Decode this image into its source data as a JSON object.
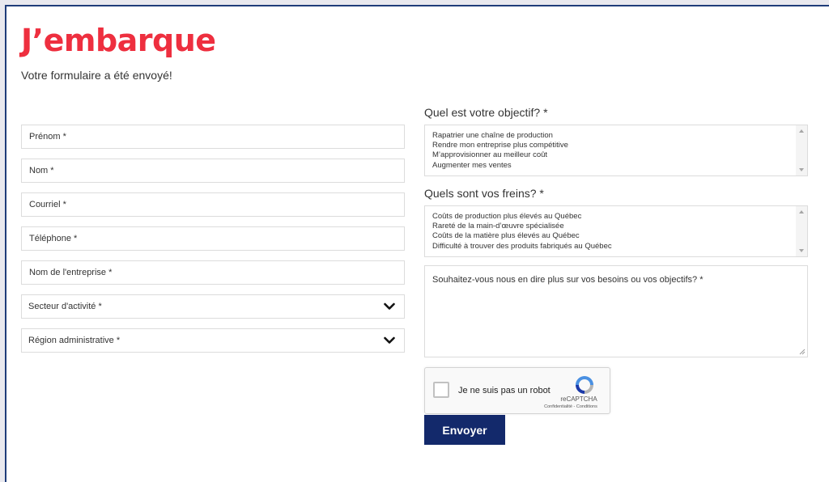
{
  "header": {
    "brand": "J’embarque",
    "success_message": "Votre formulaire a été envoyé!"
  },
  "form": {
    "fields": [
      {
        "label": "Prénom *"
      },
      {
        "label": "Nom *"
      },
      {
        "label": "Courriel *"
      },
      {
        "label": "Téléphone *"
      },
      {
        "label": "Nom de l'entreprise *"
      }
    ],
    "selects": [
      {
        "label": "Secteur d'activité *",
        "icon": "chevron-down-icon"
      },
      {
        "label": "Région administrative *",
        "icon": "chevron-down-icon"
      }
    ],
    "objectives": {
      "label": "Quel est votre objectif? *",
      "options": [
        "Rapatrier une chaîne de production",
        "Rendre mon entreprise plus compétitive",
        "M’approvisionner au meilleur coût",
        "Augmenter mes ventes"
      ]
    },
    "obstacles": {
      "label": "Quels sont vos freins? *",
      "options": [
        "Coûts de production plus élevés au Québec",
        "Rareté de la main-d’œuvre spécialisée",
        "Coûts de la matière plus élevés au Québec",
        "Difficulté à trouver des produits fabriqués au Québec"
      ]
    },
    "details": {
      "placeholder": "Souhaitez-vous nous en dire plus sur vos besoins ou vos objectifs? *"
    },
    "recaptcha": {
      "label": "Je ne suis pas un robot",
      "brand": "reCAPTCHA",
      "privacy": "Confidentialité",
      "separator": " - ",
      "terms": "Conditions"
    },
    "submit_label": "Envoyer"
  },
  "colors": {
    "brand_red": "#ee2f3f",
    "submit_blue": "#13296b",
    "frame_border": "#1f3d7a"
  }
}
